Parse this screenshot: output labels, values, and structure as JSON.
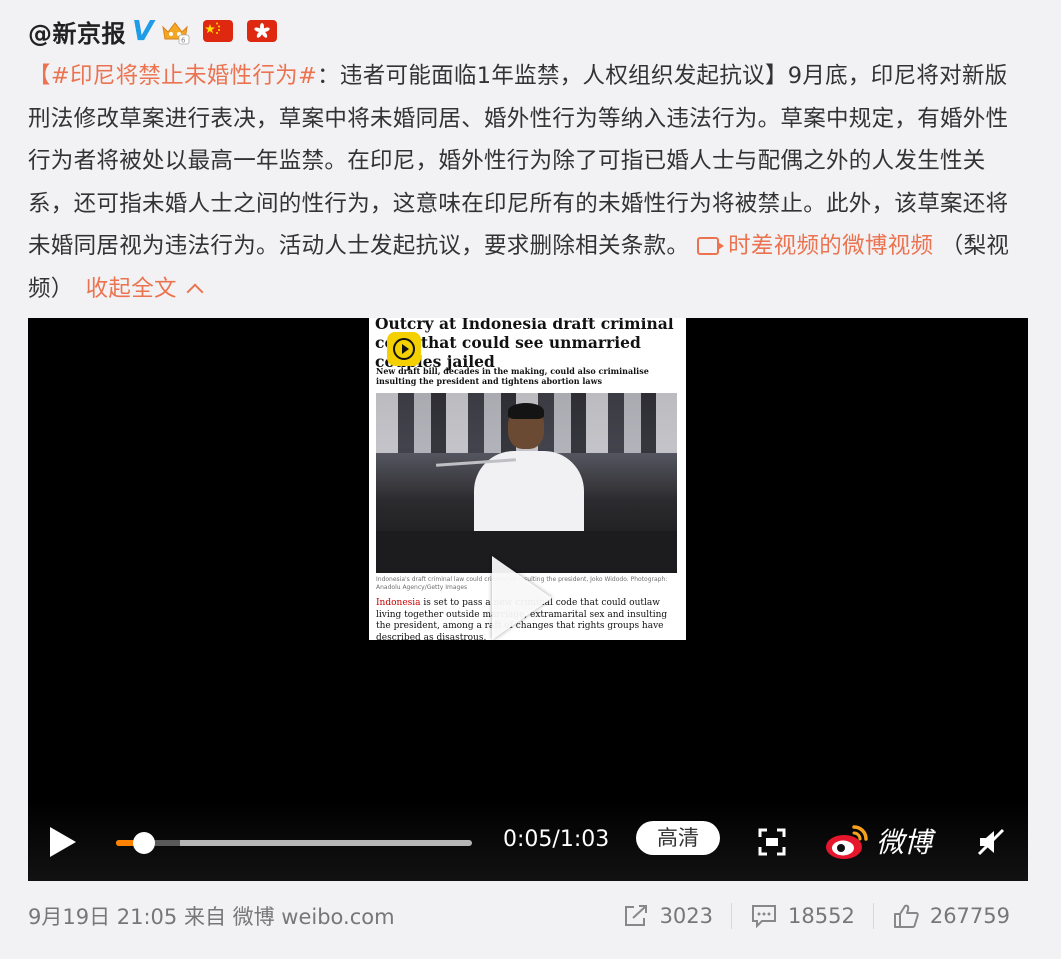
{
  "post": {
    "author": "@新京报",
    "badges": [
      "verified-v-icon",
      "crown-icon",
      "china-flag-icon",
      "hong-kong-flag-icon"
    ],
    "bracket_open": "【",
    "topic": "#印尼将禁止未婚性行为#",
    "headline_rest": "：违者可能面临1年监禁，人权组织发起抗议】",
    "body": "9月底，印尼将对新版刑法修改草案进行表决，草案中将未婚同居、婚外性行为等纳入违法行为。草案中规定，有婚外性行为者将被处以最高一年监禁。在印尼，婚外性行为除了可指已婚人士与配偶之外的人发生性关系，还可指未婚人士之间的性行为，这意味在印尼所有的未婚性行为将被禁止。此外，该草案还将未婚同居视为违法行为。活动人士发起抗议，要求删除相关条款。",
    "video_link": "时差视频的微博视频",
    "source": "（梨视频）",
    "collapse_label": "收起全文"
  },
  "video": {
    "thumb_headline": "Outcry at Indonesia draft criminal code that could see unmarried couples jailed",
    "thumb_standfirst": "New draft bill, decades in the making, could also criminalise insulting the president and tightens abortion laws",
    "thumb_caption": "Indonesia's draft criminal law could criminalise insulting the president, Joko Widodo. Photograph: Anadolu Agency/Getty Images",
    "thumb_body_lead": "Indonesia",
    "thumb_body_rest": " is set to pass a new criminal code that could outlaw living together outside marriage, extramarital sex and insulting the president, among a raft of changes that rights groups have described as disastrous.",
    "progress": 0.08,
    "buffered": 0.18,
    "time": "0:05/1:03",
    "quality_label": "高清",
    "brand_label": "微博"
  },
  "footer": {
    "meta": "9月19日 21:05 来自 微博 weibo.com",
    "reposts": "3023",
    "comments": "18552",
    "likes": "267759"
  },
  "colors": {
    "link": "#eb7350",
    "verified": "#1e9ce8",
    "progress": "#ff8200"
  }
}
